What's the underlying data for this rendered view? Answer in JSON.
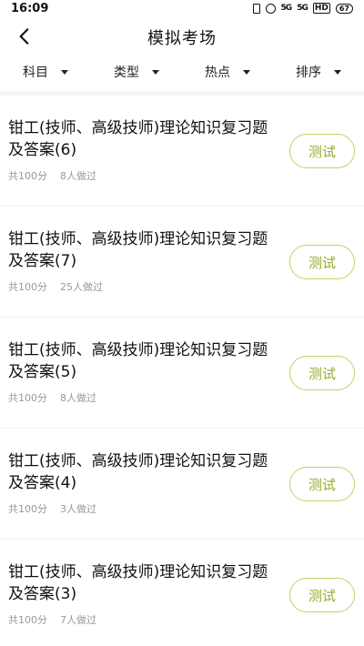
{
  "status_bar": {
    "time": "16:09",
    "signal1": "5G",
    "signal2": "5G",
    "wifi": "HD",
    "battery": "67"
  },
  "header": {
    "title": "模拟考场",
    "back_icon": "chevron-left-icon"
  },
  "filters": [
    {
      "label": "科目"
    },
    {
      "label": "类型"
    },
    {
      "label": "热点"
    },
    {
      "label": "排序"
    }
  ],
  "colors": {
    "accent_border": "#c6d062",
    "accent_text": "#9aaa26",
    "meta_text": "#999999"
  },
  "items": [
    {
      "title": "钳工(技师、高级技师)理论知识复习题及答案(6)",
      "score": "共100分",
      "count": "8人做过",
      "action": "测试"
    },
    {
      "title": "钳工(技师、高级技师)理论知识复习题及答案(7)",
      "score": "共100分",
      "count": "25人做过",
      "action": "测试"
    },
    {
      "title": "钳工(技师、高级技师)理论知识复习题及答案(5)",
      "score": "共100分",
      "count": "8人做过",
      "action": "测试"
    },
    {
      "title": "钳工(技师、高级技师)理论知识复习题及答案(4)",
      "score": "共100分",
      "count": "3人做过",
      "action": "测试"
    },
    {
      "title": "钳工(技师、高级技师)理论知识复习题及答案(3)",
      "score": "共100分",
      "count": "7人做过",
      "action": "测试"
    }
  ]
}
